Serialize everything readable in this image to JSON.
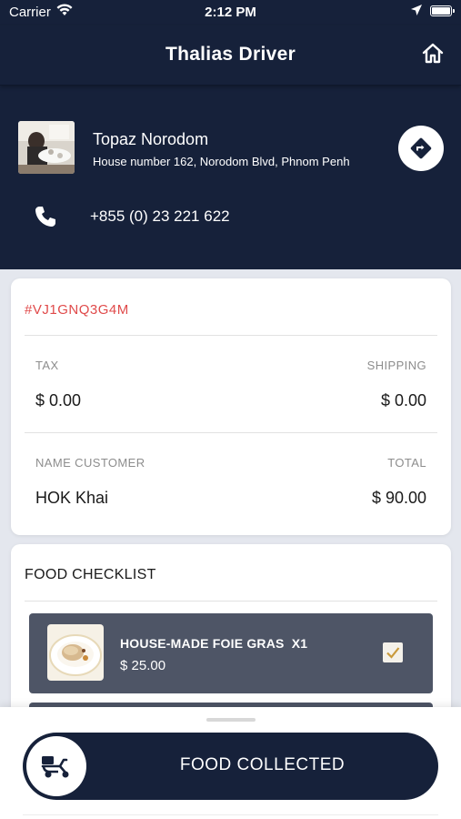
{
  "status_bar": {
    "carrier": "Carrier",
    "time": "2:12 PM"
  },
  "nav": {
    "title": "Thalias Driver"
  },
  "store": {
    "name": "Topaz Norodom",
    "address": "House number 162, Norodom Blvd, Phnom Penh",
    "phone": "+855 (0) 23 221 622"
  },
  "order": {
    "code": "#VJ1GNQ3G4M",
    "tax_label": "TAX",
    "tax_value": "$ 0.00",
    "shipping_label": "SHIPPING",
    "shipping_value": "$ 0.00",
    "customer_label": "NAME CUSTOMER",
    "customer_value": "HOK Khai",
    "total_label": "TOTAL",
    "total_value": "$ 90.00"
  },
  "checklist": {
    "title": "FOOD CHECKLIST",
    "items": [
      {
        "name": "HOUSE-MADE FOIE GRAS",
        "qty": "X1",
        "price": "$ 25.00",
        "checked": true
      }
    ]
  },
  "action": {
    "label": "FOOD COLLECTED"
  },
  "colors": {
    "primary_dark": "#16213a",
    "order_code": "#e04a4a",
    "item_bg": "#4e5566",
    "check_mark": "#c99a3c"
  }
}
